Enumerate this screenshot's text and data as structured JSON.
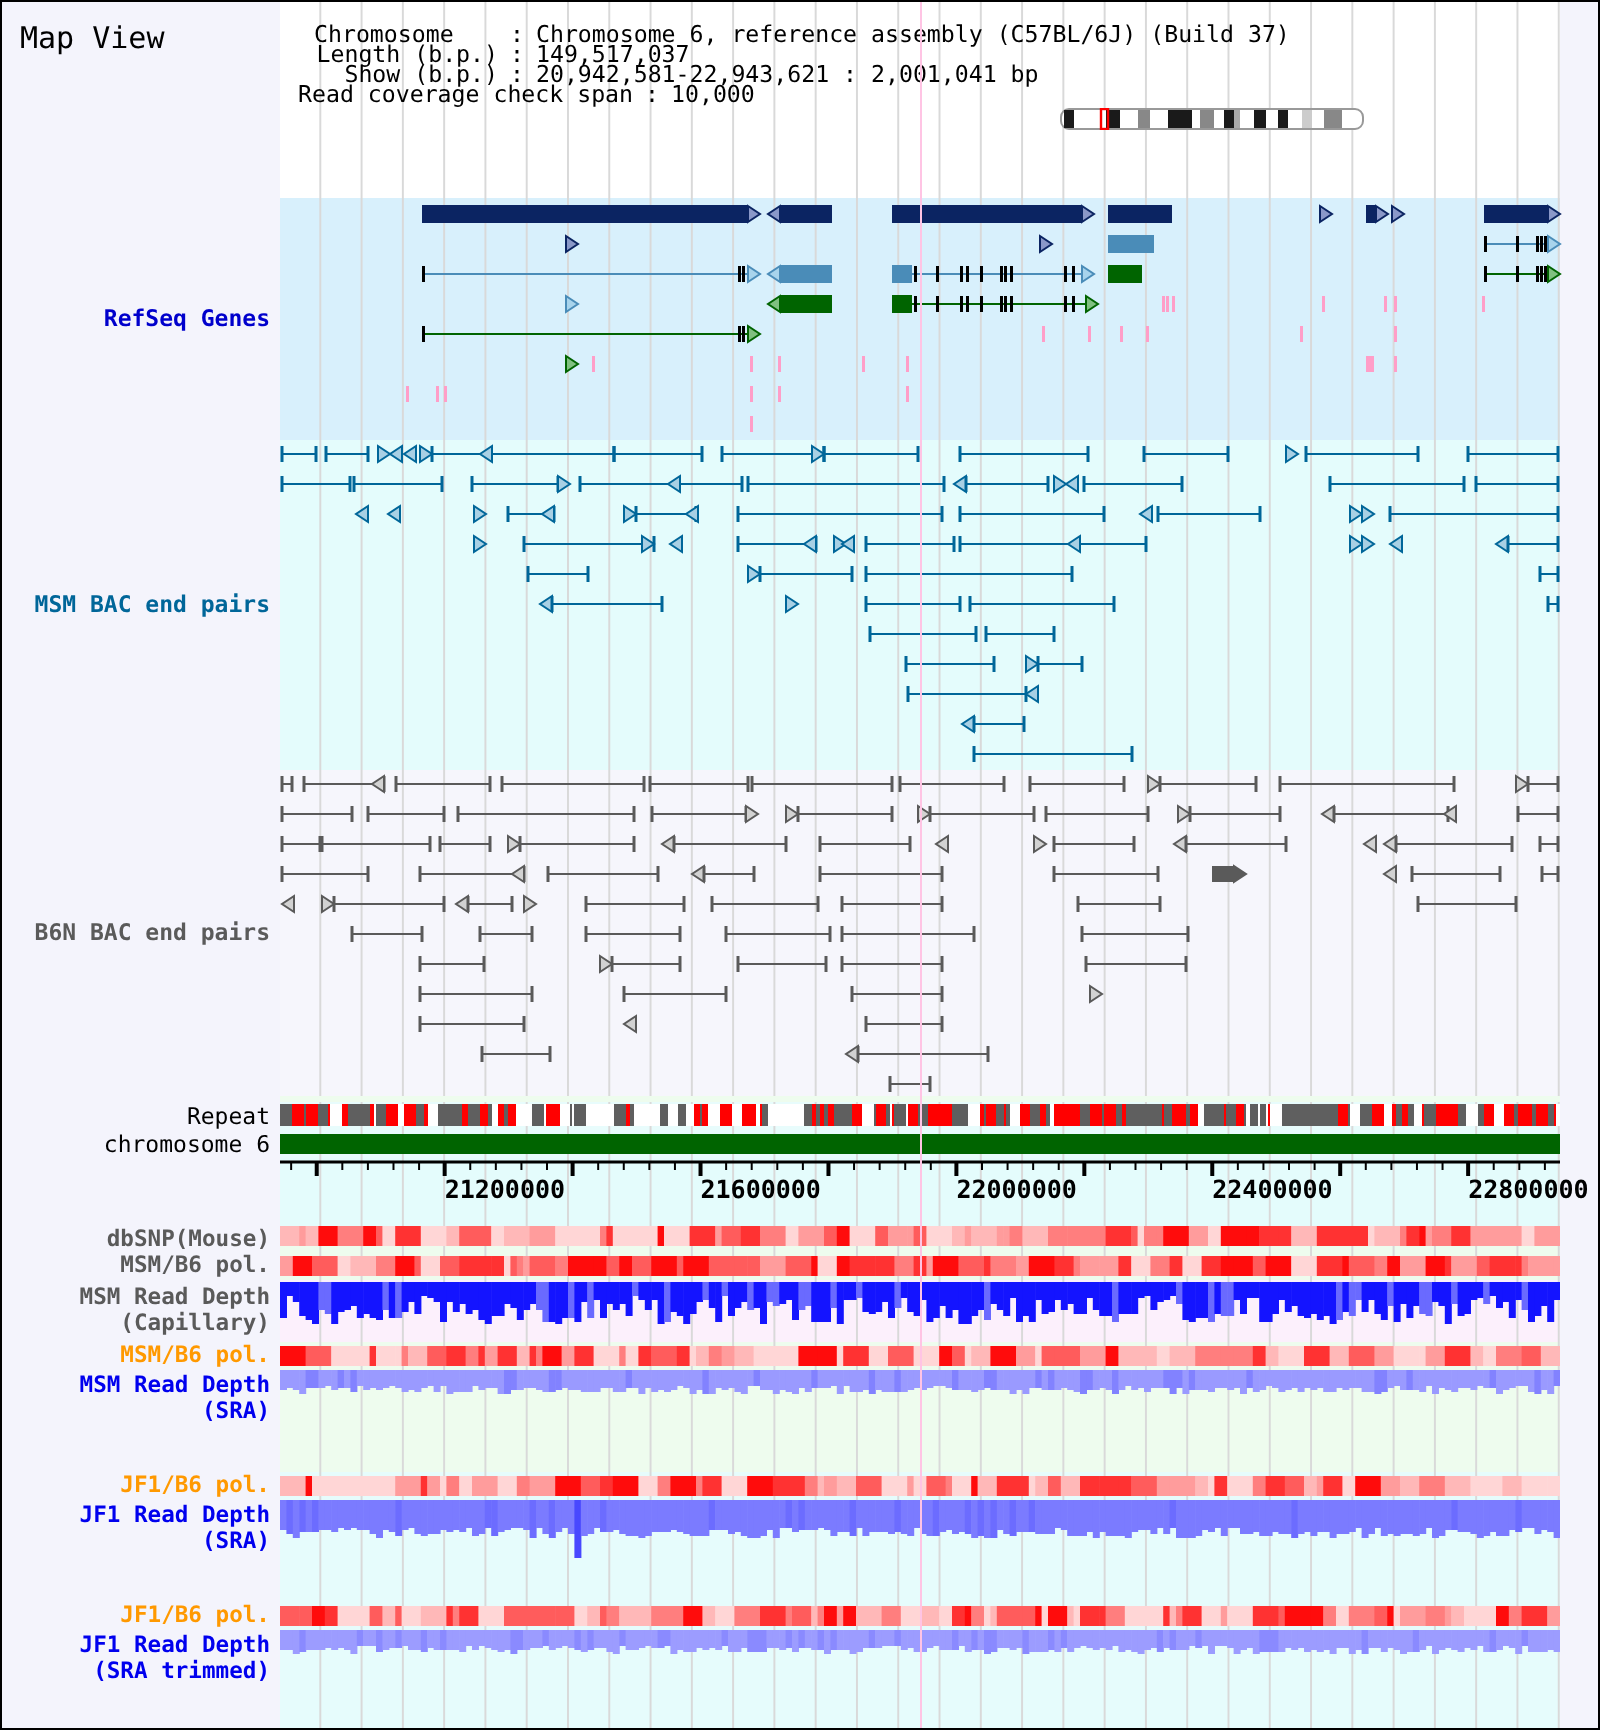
{
  "title": "Map View",
  "header": {
    "fields": [
      {
        "label": "Chromosome",
        "separator": ":",
        "value": "Chromosome 6, reference assembly (C57BL/6J) (Build 37)"
      },
      {
        "label": "Length (b.p.)",
        "separator": ":",
        "value": "149,517,037"
      },
      {
        "label": "Show (b.p.)",
        "separator": ":",
        "value": "20,942,581-22,943,621 : 2,001,041 bp"
      },
      {
        "label": "Read coverage check span",
        "separator": ":",
        "value": "10,000"
      }
    ]
  },
  "feature_tracks": [
    {
      "kind": "genes",
      "label": "RefSeq Genes",
      "color": "#0000cc"
    },
    {
      "kind": "bac_pairs",
      "label": "MSM BAC end pairs",
      "color": "#006699"
    },
    {
      "kind": "bac_pairs",
      "label": "B6N BAC end pairs",
      "color": "#5a5a5a"
    }
  ],
  "overview_tracks": [
    {
      "kind": "repeat",
      "label": "Repeat"
    },
    {
      "kind": "chromosome",
      "label": "chromosome 6"
    }
  ],
  "axis": {
    "tick_labels": [
      "21200000",
      "21600000",
      "22000000",
      "22400000",
      "22800000"
    ]
  },
  "data_tracks": [
    {
      "kind": "polymorphism",
      "label_lines": [
        "dbSNP(Mouse)"
      ],
      "color": "#5a5a5a"
    },
    {
      "kind": "polymorphism",
      "label_lines": [
        "MSM/B6 pol."
      ],
      "color": "#5a5a5a"
    },
    {
      "kind": "depth",
      "label_lines": [
        "MSM Read Depth",
        "(Capillary)"
      ],
      "color": "#5a5a5a"
    },
    {
      "kind": "polymorphism",
      "label_lines": [
        "MSM/B6 pol."
      ],
      "color": "#ff9900"
    },
    {
      "kind": "depth",
      "label_lines": [
        "MSM Read Depth",
        "(SRA)"
      ],
      "color": "#0000ee"
    },
    {
      "kind": "polymorphism",
      "label_lines": [
        "JF1/B6 pol."
      ],
      "color": "#ff9900"
    },
    {
      "kind": "depth",
      "label_lines": [
        "JF1 Read Depth",
        "(SRA)"
      ],
      "color": "#0000ee"
    },
    {
      "kind": "polymorphism",
      "label_lines": [
        "JF1/B6 pol."
      ],
      "color": "#ff9900"
    },
    {
      "kind": "depth",
      "label_lines": [
        "JF1 Read Depth",
        "(SRA trimmed)"
      ],
      "color": "#0000ee"
    }
  ]
}
